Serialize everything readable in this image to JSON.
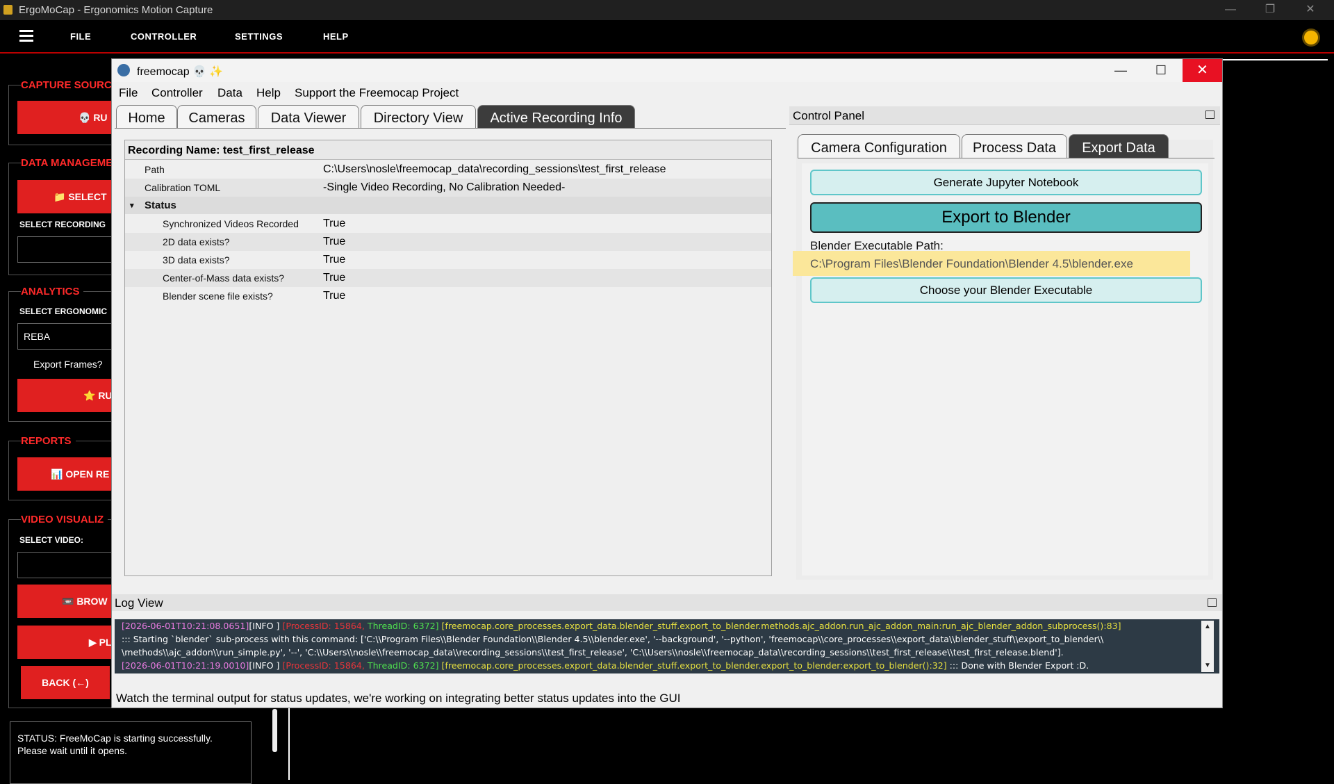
{
  "outer": {
    "title": "ErgoMoCap - Ergonomics Motion Capture",
    "menu": [
      "FILE",
      "CONTROLLER",
      "SETTINGS",
      "HELP"
    ],
    "controls": [
      "—",
      "❐",
      "✕"
    ]
  },
  "sidebar": {
    "capture_source": {
      "title": "CAPTURE SOURCE",
      "button": "💀 RU"
    },
    "data_management": {
      "title": "DATA MANAGEMENT",
      "button": "📁 SELECT",
      "label": "SELECT RECORDING"
    },
    "analytics": {
      "title": "ANALYTICS",
      "label": "SELECT ERGONOMIC",
      "value": "REBA",
      "export_frames": "Export Frames?",
      "button": "⭐ RU"
    },
    "reports": {
      "title": "REPORTS",
      "button": "📊 OPEN RE"
    },
    "video": {
      "title": "VIDEO VISUALIZ",
      "label": "SELECT VIDEO:",
      "browse_button": "📼 BROW",
      "play_button": "▶ PL",
      "back_button": "BACK (←)"
    },
    "status": "STATUS: FreeMoCap is starting successfully. Please wait until it opens."
  },
  "freemocap": {
    "title": "freemocap 💀 ✨",
    "menu": [
      "File",
      "Controller",
      "Data",
      "Help",
      "Support the Freemocap Project"
    ],
    "tabs": [
      "Home",
      "Cameras",
      "Data Viewer",
      "Directory View",
      "Active Recording Info"
    ],
    "recording": {
      "header": "Recording Name: test_first_release",
      "path_label": "Path",
      "path_value": "C:\\Users\\nosle\\freemocap_data\\recording_sessions\\test_first_release",
      "calib_label": "Calibration TOML",
      "calib_value": "-Single Video Recording, No Calibration Needed-",
      "status_group": "Status",
      "status": [
        {
          "label": "Synchronized Videos Recorded",
          "value": "True"
        },
        {
          "label": "2D data exists?",
          "value": "True"
        },
        {
          "label": "3D data exists?",
          "value": "True"
        },
        {
          "label": "Center-of-Mass data exists?",
          "value": "True"
        },
        {
          "label": "Blender scene file exists?",
          "value": "True"
        }
      ]
    },
    "control_panel": {
      "title": "Control Panel",
      "tabs": [
        "Camera Configuration",
        "Process Data",
        "Export Data"
      ],
      "jupyter_button": "Generate Jupyter Notebook",
      "blender_button": "Export to Blender",
      "path_label": "Blender Executable Path:",
      "path_value": "C:\\Program Files\\Blender Foundation\\Blender 4.5\\blender.exe",
      "choose_button": "Choose your Blender Executable"
    },
    "log": {
      "title": "Log View",
      "line1_ts": "[2026-06-01T10:21:08.0651]",
      "line1_level": "[INFO ] ",
      "line1_pid": "[ProcessID: 15864, ",
      "line1_tid": "ThreadID: 6372] ",
      "line1_src": "[freemocap.core_processes.export_data.blender_stuff.export_to_blender.methods.ajc_addon.run_ajc_addon_main:run_ajc_blender_addon_subprocess():83]",
      "line2": "::: Starting `blender` sub-process with this command: ['C:\\\\Program Files\\\\Blender Foundation\\\\Blender 4.5\\\\blender.exe', '--background', '--python', 'freemocap\\\\core_processes\\\\export_data\\\\blender_stuff\\\\export_to_blender\\\\",
      "line3": "\\methods\\\\ajc_addon\\\\run_simple.py', '--', 'C:\\\\Users\\\\nosle\\\\freemocap_data\\\\recording_sessions\\\\test_first_release', 'C:\\\\Users\\\\nosle\\\\freemocap_data\\\\recording_sessions\\\\test_first_release\\\\test_first_release.blend'].",
      "line4_ts": "[2026-06-01T10:21:19.0010]",
      "line4_level": "[INFO ] ",
      "line4_pid": "[ProcessID: 15864, ",
      "line4_tid": "ThreadID: 6372] ",
      "line4_src": "[freemocap.core_processes.export_data.blender_stuff.export_to_blender.export_to_blender:export_to_blender():32]",
      "line4_msg": " ::: Done with Blender Export :D."
    },
    "status_bar": "Watch the terminal output for status updates, we're working on integrating better status updates into the GUI"
  },
  "colors": {
    "accent_red": "#e02020",
    "teal": "#5abec0",
    "highlight": "#fbe79a",
    "log_bg": "#2d3a45"
  }
}
